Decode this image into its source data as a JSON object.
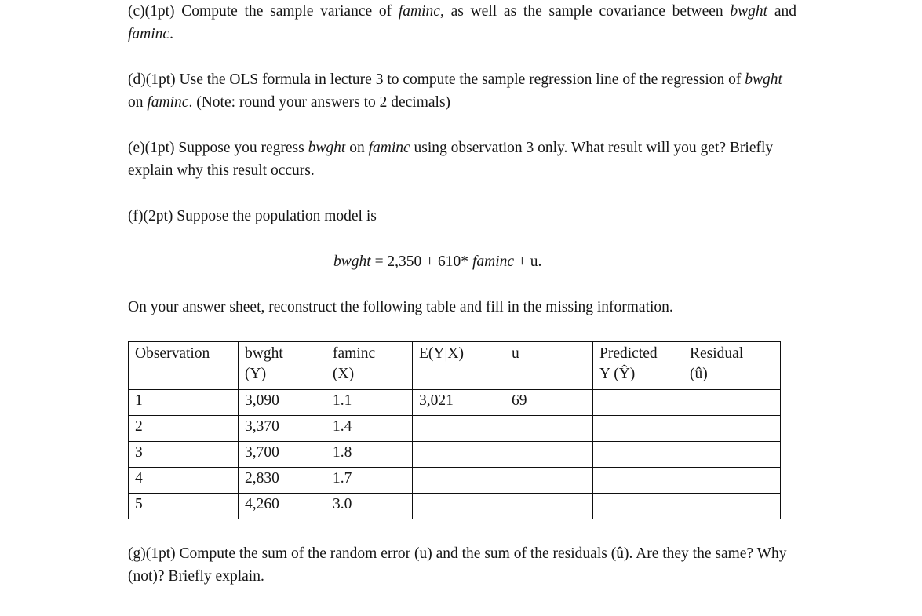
{
  "document": {
    "paragraphs": [
      {
        "id": "part-c",
        "align": "justify",
        "segments": [
          {
            "text": "(c)(1pt) Compute the sample variance of ",
            "style": "normal"
          },
          {
            "text": "faminc",
            "style": "italic"
          },
          {
            "text": ", as well as the sample covariance between ",
            "style": "normal"
          },
          {
            "text": "bwght",
            "style": "italic"
          },
          {
            "text": " and ",
            "style": "normal"
          },
          {
            "text": "faminc",
            "style": "italic"
          },
          {
            "text": ".",
            "style": "normal"
          }
        ]
      },
      {
        "id": "part-d",
        "align": "left",
        "segments": [
          {
            "text": "(d)(1pt) Use the OLS formula in lecture 3 to compute the sample regression line of the regression of ",
            "style": "normal"
          },
          {
            "text": "bwght",
            "style": "italic"
          },
          {
            "text": " on ",
            "style": "normal"
          },
          {
            "text": "faminc",
            "style": "italic"
          },
          {
            "text": ". (Note: round your answers to 2 decimals)",
            "style": "normal"
          }
        ]
      },
      {
        "id": "part-e",
        "align": "left",
        "segments": [
          {
            "text": "(e)(1pt) Suppose you regress ",
            "style": "normal"
          },
          {
            "text": "bwght",
            "style": "italic"
          },
          {
            "text": " on ",
            "style": "normal"
          },
          {
            "text": "faminc",
            "style": "italic"
          },
          {
            "text": " using observation 3 only. What result will you get? Briefly explain why this result occurs.",
            "style": "normal"
          }
        ]
      },
      {
        "id": "part-f",
        "align": "left",
        "segments": [
          {
            "text": "(f)(2pt) Suppose the population model is",
            "style": "normal"
          }
        ]
      }
    ],
    "equation": {
      "id": "population-model",
      "segments": [
        {
          "text": "bwght",
          "style": "italic"
        },
        {
          "text": " = 2,350 + 610* ",
          "style": "normal"
        },
        {
          "text": "faminc",
          "style": "italic"
        },
        {
          "text": " + u.",
          "style": "normal"
        }
      ],
      "plain": "bwght = 2,350 + 610* faminc + u."
    },
    "table_intro": "On your answer sheet, reconstruct the following table and fill in the missing information.",
    "closing_paragraph": "(g)(1pt) Compute the sum of the random error (u) and the sum of the residuals (û). Are they the same? Why (not)? Briefly explain."
  },
  "table": {
    "headers": [
      {
        "line1": "Observation",
        "line2": ""
      },
      {
        "line1": "bwght",
        "line2": "(Y)"
      },
      {
        "line1": "faminc",
        "line2": "(X)"
      },
      {
        "line1": "E(Y|X)",
        "line2": ""
      },
      {
        "line1": "u",
        "line2": ""
      },
      {
        "line1": "Predicted",
        "line2": "Y (Ŷ)"
      },
      {
        "line1": "Residual",
        "line2": "(û)"
      }
    ],
    "rows": [
      {
        "observation": "1",
        "bwght": "3,090",
        "faminc": "1.1",
        "eyx": "3,021",
        "u": "69",
        "predicted": "",
        "residual": ""
      },
      {
        "observation": "2",
        "bwght": "3,370",
        "faminc": "1.4",
        "eyx": "",
        "u": "",
        "predicted": "",
        "residual": ""
      },
      {
        "observation": "3",
        "bwght": "3,700",
        "faminc": "1.8",
        "eyx": "",
        "u": "",
        "predicted": "",
        "residual": ""
      },
      {
        "observation": "4",
        "bwght": "2,830",
        "faminc": "1.7",
        "eyx": "",
        "u": "",
        "predicted": "",
        "residual": ""
      },
      {
        "observation": "5",
        "bwght": "4,260",
        "faminc": "3.0",
        "eyx": "",
        "u": "",
        "predicted": "",
        "residual": ""
      }
    ]
  },
  "colors": {
    "page_background": "#ffffff",
    "text": "#161616",
    "table_border": "#0f0f0f"
  }
}
